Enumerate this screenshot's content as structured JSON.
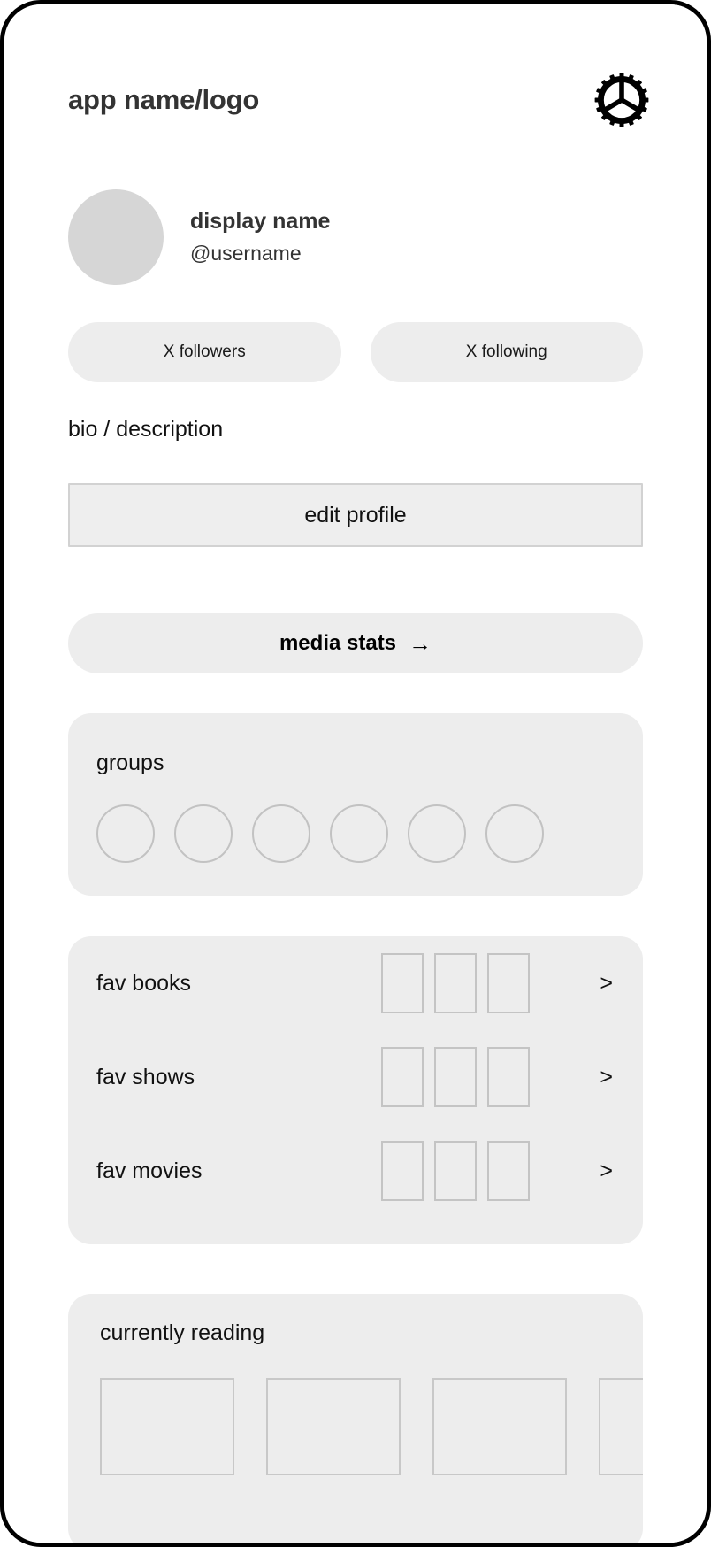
{
  "header": {
    "app_title": "app name/logo",
    "settings_icon": "gear-icon"
  },
  "profile": {
    "display_name": "display name",
    "username": "@username",
    "avatar_icon": "avatar-placeholder",
    "bio": "bio / description",
    "stats": [
      {
        "label": "X followers"
      },
      {
        "label": "X following"
      }
    ],
    "edit_profile_label": "edit profile"
  },
  "media_stats": {
    "label": "media stats",
    "arrow": "→"
  },
  "groups": {
    "title": "groups",
    "circle_count": 6
  },
  "favourites": {
    "chevron": ">",
    "thumbs_per_row": 3,
    "rows": [
      {
        "label": "fav books"
      },
      {
        "label": "fav shows"
      },
      {
        "label": "fav movies"
      }
    ]
  },
  "currently_reading": {
    "title": "currently reading",
    "thumb_count": 4
  },
  "colors": {
    "card_bg": "#ededed",
    "button_bg": "#eeeeee",
    "button_border": "#d2d2d2",
    "avatar_bg": "#d6d6d6",
    "outline": "#c4c4c4",
    "text": "#111111",
    "heading_text": "#333333",
    "frame": "#000000",
    "page_bg": "#ffffff"
  }
}
